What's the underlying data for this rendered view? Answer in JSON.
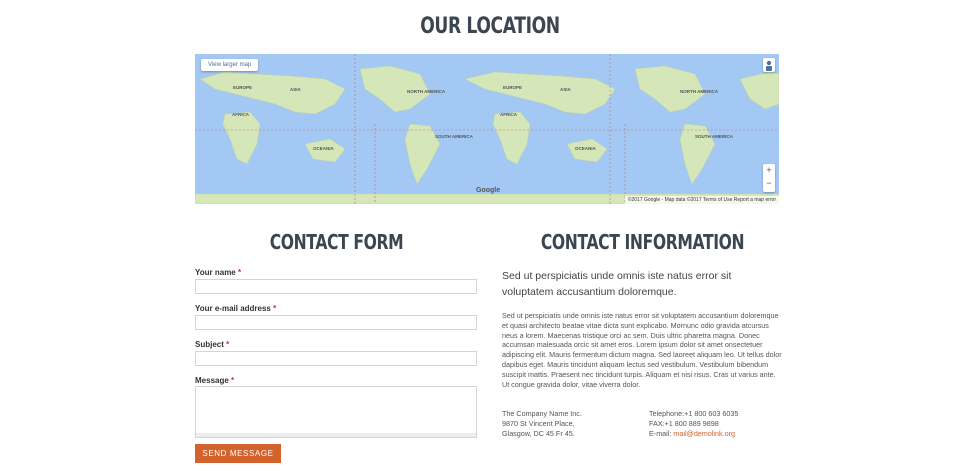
{
  "location": {
    "title": "OUR LOCATION"
  },
  "map": {
    "view_larger": "View larger map",
    "zoom_in": "+",
    "zoom_out": "−",
    "google": "Google",
    "attribution": "©2017 Google - Map data ©2017   Terms of Use   Report a map error",
    "labels": [
      "EUROPE",
      "ASIA",
      "AFRICA",
      "OCEANIA",
      "NORTH AMERICA",
      "SOUTH AMERICA",
      "EUROPE",
      "ASIA",
      "AFRICA",
      "OCEANIA",
      "NORTH AMERICA",
      "SOUTH AMERICA"
    ]
  },
  "contact_form": {
    "title": "CONTACT FORM",
    "name_label": "Your name",
    "email_label": "Your e-mail address",
    "subject_label": "Subject",
    "message_label": "Message",
    "required_mark": "*",
    "send_label": "SEND MESSAGE"
  },
  "contact_info": {
    "title": "CONTACT INFORMATION",
    "lead": "Sed ut perspiciatis unde omnis iste natus error sit voluptatem accusantium doloremque.",
    "body": "Sed ut perspiciatis unde omnis iste natus error sit voluptatem accusantium doloremque et quasi architecto beatae vitae dicta sunt explicabo. Mornunc odio gravida atcursus neus a lorem. Maecenas tristique orci ac sem. Duis ultric pharetra magna. Donec accumsan malesuada orcic sit amet eros. Lorem ipsum dolor sit amet onsectetuer adipiscing elit. Mauris fermentum dictum magna. Sed laoreet aliquam leo. Ut tellus dolor dapibus eget. Mauris tincidunt aliquam lectus sed vestibulum. Vestibulum bibendum suscipit mattis. Praesent nec tincidunt turpis. Aliquam et nisi risus. Cras ut varius ante. Ut congue gravida dolor, vitae viverra dolor.",
    "company": "The Company Name Inc.",
    "street": "9870 St Vincent Place,",
    "city": "Glasgow, DC 45 Fr 45.",
    "telephone": "Telephone:+1 800 603 6035",
    "fax": "FAX:+1 800 889 9898",
    "email_label": "E-mail: ",
    "email": "mail@demolink.org"
  },
  "colors": {
    "accent": "#d4622c",
    "heading": "#3b4650",
    "water": "#a4c8f4",
    "land": "#cfe3b2"
  }
}
